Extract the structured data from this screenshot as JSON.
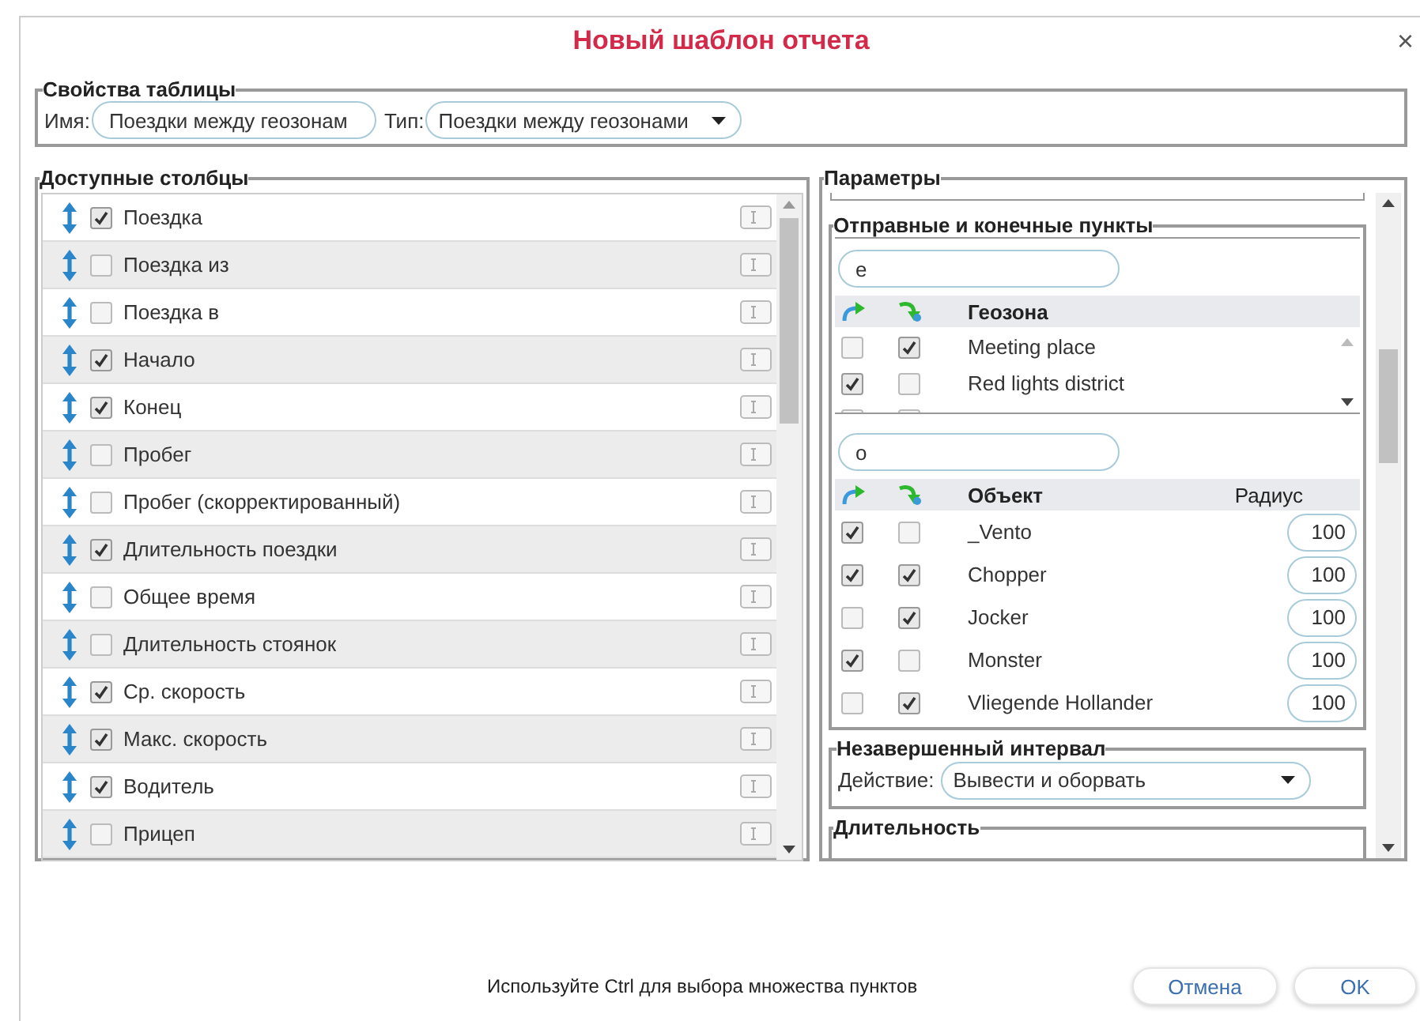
{
  "dialog": {
    "title": "Новый шаблон отчета",
    "close": "×"
  },
  "table_properties": {
    "legend": "Свойства таблицы",
    "name_label": "Имя:",
    "name_value": "Поездки между геозонам",
    "type_label": "Тип:",
    "type_value": "Поездки между геозонами"
  },
  "available_columns": {
    "legend": "Доступные столбцы",
    "rows": [
      {
        "label": "Поездка",
        "checked": true
      },
      {
        "label": "Поездка из",
        "checked": false
      },
      {
        "label": "Поездка в",
        "checked": false
      },
      {
        "label": "Начало",
        "checked": true
      },
      {
        "label": "Конец",
        "checked": true
      },
      {
        "label": "Пробег",
        "checked": false
      },
      {
        "label": "Пробег (скорректированный)",
        "checked": false
      },
      {
        "label": "Длительность поездки",
        "checked": true
      },
      {
        "label": "Общее время",
        "checked": false
      },
      {
        "label": "Длительность стоянок",
        "checked": false
      },
      {
        "label": "Ср. скорость",
        "checked": true
      },
      {
        "label": "Макс. скорость",
        "checked": true
      },
      {
        "label": "Водитель",
        "checked": true
      },
      {
        "label": "Прицеп",
        "checked": false
      }
    ]
  },
  "parameters": {
    "legend": "Параметры",
    "start_end": {
      "legend": "Отправные и конечные пункты",
      "geozone_search": {
        "value": "e"
      },
      "geozone_table": {
        "column": "Геозона",
        "rows": [
          {
            "name": "Meeting place",
            "from": false,
            "to": true
          },
          {
            "name": "Red lights district",
            "from": true,
            "to": false
          }
        ]
      },
      "object_search": {
        "value": "o"
      },
      "object_table": {
        "column": "Объект",
        "radius_column": "Радиус",
        "rows": [
          {
            "name": "_Vento",
            "from": true,
            "to": false,
            "radius": "100"
          },
          {
            "name": "Chopper",
            "from": true,
            "to": true,
            "radius": "100"
          },
          {
            "name": "Jocker",
            "from": false,
            "to": true,
            "radius": "100"
          },
          {
            "name": "Monster",
            "from": true,
            "to": false,
            "radius": "100"
          },
          {
            "name": "Vliegende Hollander",
            "from": false,
            "to": true,
            "radius": "100"
          }
        ]
      }
    },
    "incomplete_interval": {
      "legend": "Незавершенный интервал",
      "action_label": "Действие:",
      "action_value": "Вывести и оборвать"
    },
    "duration": {
      "legend": "Длительность"
    }
  },
  "footer": {
    "hint": "Используйте Ctrl для выбора множества пунктов",
    "buttons": [
      "Отмена",
      "OK"
    ]
  }
}
